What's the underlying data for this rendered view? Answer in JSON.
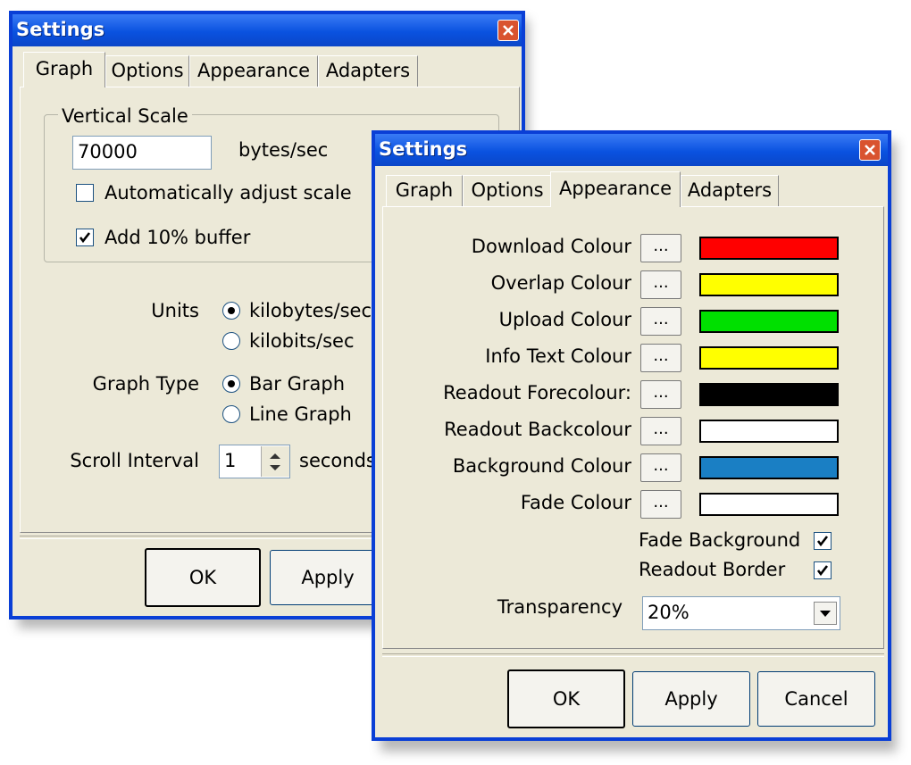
{
  "back_window": {
    "title": "Settings",
    "tabs": [
      "Graph",
      "Options",
      "Appearance",
      "Adapters"
    ],
    "active_tab": "Graph",
    "vertical_scale": {
      "group_label": "Vertical Scale",
      "value": "70000",
      "unit": "bytes/sec",
      "auto_adjust": {
        "label": "Automatically adjust scale",
        "checked": false
      },
      "buffer": {
        "label": "Add 10% buffer",
        "checked": true
      }
    },
    "units": {
      "label": "Units",
      "options": [
        {
          "label": "kilobytes/sec",
          "selected": true
        },
        {
          "label": "kilobits/sec",
          "selected": false
        }
      ]
    },
    "graph_type": {
      "label": "Graph Type",
      "options": [
        {
          "label": "Bar Graph",
          "selected": true
        },
        {
          "label": "Line Graph",
          "selected": false
        }
      ]
    },
    "scroll_interval": {
      "label": "Scroll Interval",
      "value": "1",
      "unit": "seconds"
    },
    "buttons": {
      "ok": "OK",
      "apply": "Apply"
    }
  },
  "front_window": {
    "title": "Settings",
    "tabs": [
      "Graph",
      "Options",
      "Appearance",
      "Adapters"
    ],
    "active_tab": "Appearance",
    "browse_label": "...",
    "colours": [
      {
        "label": "Download Colour",
        "color": "#ff0000"
      },
      {
        "label": "Overlap Colour",
        "color": "#ffff00"
      },
      {
        "label": "Upload Colour",
        "color": "#00e000"
      },
      {
        "label": "Info Text Colour",
        "color": "#ffff00"
      },
      {
        "label": "Readout Forecolour:",
        "color": "#000000"
      },
      {
        "label": "Readout Backcolour",
        "color": "#ffffff"
      },
      {
        "label": "Background Colour",
        "color": "#1a7fc4"
      },
      {
        "label": "Fade Colour",
        "color": "#ffffff"
      }
    ],
    "fade_background": {
      "label": "Fade Background",
      "checked": true
    },
    "readout_border": {
      "label": "Readout Border",
      "checked": true
    },
    "transparency": {
      "label": "Transparency",
      "value": "20%"
    },
    "buttons": {
      "ok": "OK",
      "apply": "Apply",
      "cancel": "Cancel"
    }
  }
}
